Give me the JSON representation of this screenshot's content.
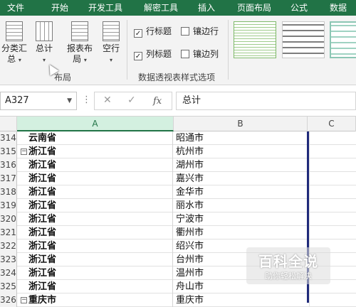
{
  "ribbon_tabs": [
    "文件",
    "开始",
    "开发工具",
    "解密工具",
    "插入",
    "页面布局",
    "公式",
    "数据"
  ],
  "layout_group": {
    "buttons": [
      {
        "label1": "分类汇",
        "label2": "总"
      },
      {
        "label1": "总计",
        "label2": ""
      },
      {
        "label1": "报表布",
        "label2": "局"
      },
      {
        "label1": "空行",
        "label2": ""
      }
    ],
    "label": "布局"
  },
  "style_options": {
    "row_headers": "行标题",
    "banded_rows": "镶边行",
    "col_headers": "列标题",
    "banded_cols": "镶边列",
    "group_label": "数据透视表样式选项",
    "row_headers_checked": true,
    "col_headers_checked": true,
    "banded_rows_checked": false,
    "banded_cols_checked": false
  },
  "formula_bar": {
    "name_box": "A327",
    "content": "总计",
    "cancel": "✕",
    "enter": "✓",
    "fx": "fx",
    "dots": "⋮"
  },
  "columns": [
    "A",
    "B",
    "C"
  ],
  "rows": [
    {
      "num": "314",
      "a": "云南省",
      "b": "昭通市",
      "expander": false
    },
    {
      "num": "315",
      "a": "浙江省",
      "b": "杭州市",
      "expander": true
    },
    {
      "num": "316",
      "a": "浙江省",
      "b": "湖州市",
      "expander": false
    },
    {
      "num": "317",
      "a": "浙江省",
      "b": "嘉兴市",
      "expander": false
    },
    {
      "num": "318",
      "a": "浙江省",
      "b": "金华市",
      "expander": false
    },
    {
      "num": "319",
      "a": "浙江省",
      "b": "丽水市",
      "expander": false
    },
    {
      "num": "320",
      "a": "浙江省",
      "b": "宁波市",
      "expander": false
    },
    {
      "num": "321",
      "a": "浙江省",
      "b": "衢州市",
      "expander": false
    },
    {
      "num": "322",
      "a": "浙江省",
      "b": "绍兴市",
      "expander": false
    },
    {
      "num": "323",
      "a": "浙江省",
      "b": "台州市",
      "expander": false
    },
    {
      "num": "324",
      "a": "浙江省",
      "b": "温州市",
      "expander": false
    },
    {
      "num": "325",
      "a": "浙江省",
      "b": "舟山市",
      "expander": false
    },
    {
      "num": "326",
      "a": "重庆市",
      "b": "重庆市",
      "expander": true
    }
  ],
  "watermark": {
    "title": "百科全说",
    "subtitle": "助你轻松解决"
  }
}
